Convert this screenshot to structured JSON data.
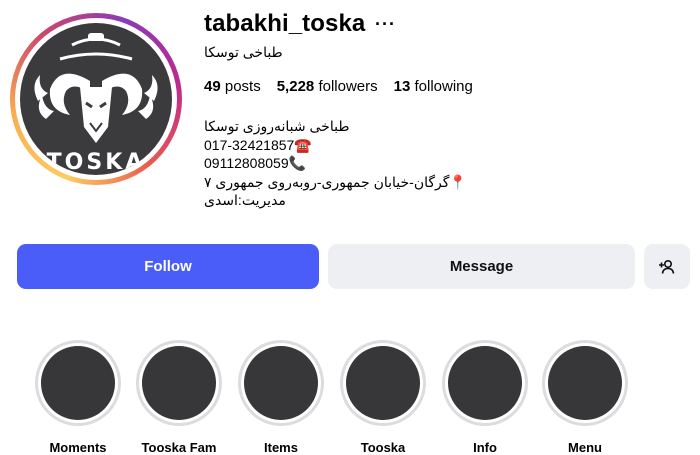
{
  "profile": {
    "username": "tabakhi_toska",
    "full_name": "طباخی توسکا",
    "avatar_text": "TOSKA",
    "stats": {
      "posts_count": "49",
      "posts_label": "posts",
      "followers_count": "5,228",
      "followers_label": "followers",
      "following_count": "13",
      "following_label": "following"
    },
    "bio": [
      "طباخی شبانه‌روزی توسکا",
      "017-32421857☎️",
      "09112808059📞",
      "📍گرگان-خیابان جمهوری-روبه‌روی جمهوری ۷",
      "مدیریت:اسدی"
    ]
  },
  "actions": {
    "follow_label": "Follow",
    "message_label": "Message"
  },
  "highlights": [
    {
      "label": "Moments"
    },
    {
      "label": "Tooska Fam"
    },
    {
      "label": "Items"
    },
    {
      "label": "Tooska"
    },
    {
      "label": "Info"
    },
    {
      "label": "Menu"
    }
  ],
  "icons": {
    "more": "more-options-icon",
    "add_user": "add-user-icon"
  },
  "colors": {
    "follow_button": "#4a5df9",
    "secondary_button": "#eeeff2",
    "avatar_background": "#3b3b3d"
  }
}
